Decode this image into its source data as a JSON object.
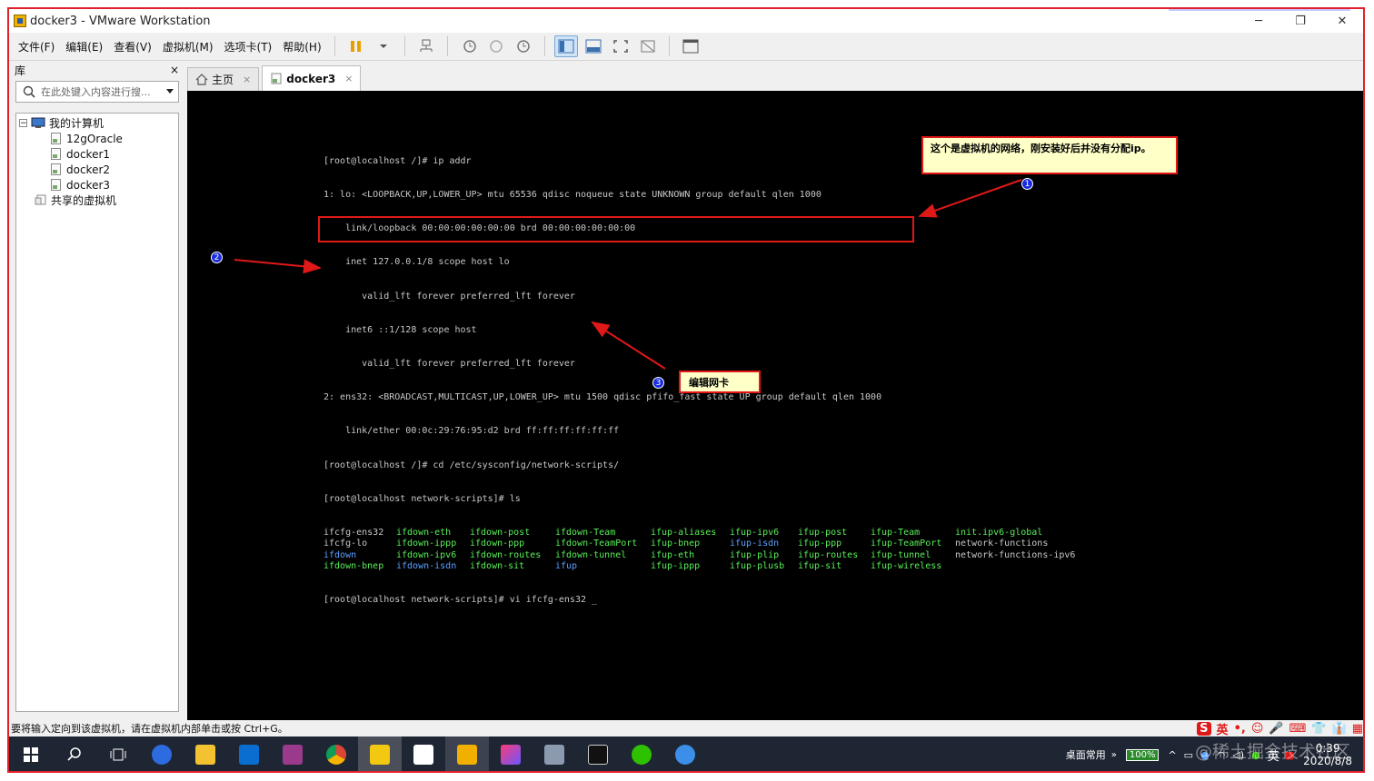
{
  "window": {
    "title": "docker3 - VMware Workstation",
    "minimize": "─",
    "restore": "❐",
    "close": "✕"
  },
  "menu": [
    "文件(F)",
    "编辑(E)",
    "查看(V)",
    "虚拟机(M)",
    "选项卡(T)",
    "帮助(H)"
  ],
  "library": {
    "title": "库",
    "close": "×",
    "search_placeholder": "在此处键入内容进行搜...",
    "tree": {
      "root": "我的计算机",
      "vms": [
        "12gOracle",
        "docker1",
        "docker2",
        "docker3"
      ],
      "shared": "共享的虚拟机"
    }
  },
  "tabs": [
    {
      "label": "主页",
      "close": "×"
    },
    {
      "label": "docker3",
      "close": "×"
    }
  ],
  "terminal": {
    "lines": [
      "[root@localhost /]# ip addr",
      "1: lo: <LOOPBACK,UP,LOWER_UP> mtu 65536 qdisc noqueue state UNKNOWN group default qlen 1000",
      "    link/loopback 00:00:00:00:00:00 brd 00:00:00:00:00:00",
      "    inet 127.0.0.1/8 scope host lo",
      "       valid_lft forever preferred_lft forever",
      "    inet6 ::1/128 scope host",
      "       valid_lft forever preferred_lft forever",
      "2: ens32: <BROADCAST,MULTICAST,UP,LOWER_UP> mtu 1500 qdisc pfifo_fast state UP group default qlen 1000",
      "    link/ether 00:0c:29:76:95:d2 brd ff:ff:ff:ff:ff:ff",
      "[root@localhost /]# cd /etc/sysconfig/network-scripts/",
      "[root@localhost network-scripts]# ls"
    ],
    "ls_rows": [
      [
        {
          "t": "ifcfg-ens32",
          "c": "w"
        },
        {
          "t": "ifdown-eth",
          "c": "g"
        },
        {
          "t": "ifdown-post",
          "c": "g"
        },
        {
          "t": "ifdown-Team",
          "c": "g"
        },
        {
          "t": "ifup-aliases",
          "c": "g"
        },
        {
          "t": "ifup-ipv6",
          "c": "g"
        },
        {
          "t": "ifup-post",
          "c": "g"
        },
        {
          "t": "ifup-Team",
          "c": "g"
        },
        {
          "t": "init.ipv6-global",
          "c": "g"
        }
      ],
      [
        {
          "t": "ifcfg-lo",
          "c": "w"
        },
        {
          "t": "ifdown-ippp",
          "c": "g"
        },
        {
          "t": "ifdown-ppp",
          "c": "g"
        },
        {
          "t": "ifdown-TeamPort",
          "c": "g"
        },
        {
          "t": "ifup-bnep",
          "c": "g"
        },
        {
          "t": "ifup-isdn",
          "c": "b"
        },
        {
          "t": "ifup-ppp",
          "c": "g"
        },
        {
          "t": "ifup-TeamPort",
          "c": "g"
        },
        {
          "t": "network-functions",
          "c": "w"
        }
      ],
      [
        {
          "t": "ifdown",
          "c": "b"
        },
        {
          "t": "ifdown-ipv6",
          "c": "g"
        },
        {
          "t": "ifdown-routes",
          "c": "g"
        },
        {
          "t": "ifdown-tunnel",
          "c": "g"
        },
        {
          "t": "ifup-eth",
          "c": "g"
        },
        {
          "t": "ifup-plip",
          "c": "g"
        },
        {
          "t": "ifup-routes",
          "c": "g"
        },
        {
          "t": "ifup-tunnel",
          "c": "g"
        },
        {
          "t": "network-functions-ipv6",
          "c": "w"
        }
      ],
      [
        {
          "t": "ifdown-bnep",
          "c": "g"
        },
        {
          "t": "ifdown-isdn",
          "c": "b"
        },
        {
          "t": "ifdown-sit",
          "c": "g"
        },
        {
          "t": "ifup",
          "c": "b"
        },
        {
          "t": "ifup-ippp",
          "c": "g"
        },
        {
          "t": "ifup-plusb",
          "c": "g"
        },
        {
          "t": "ifup-sit",
          "c": "g"
        },
        {
          "t": "ifup-wireless",
          "c": "g"
        },
        {
          "t": "",
          "c": "w"
        }
      ]
    ],
    "last_line": "[root@localhost network-scripts]# vi ifcfg-ens32 _"
  },
  "annotations": {
    "callout1": "这个是虚拟机的网络，刚安装好后并没有分配ip。",
    "callout3": "编辑网卡",
    "m1": "1",
    "m2": "2",
    "m3": "3"
  },
  "status": {
    "text": "要将输入定向到该虚拟机，请在虚拟机内部单击或按 Ctrl+G。",
    "ime": [
      "S",
      "英",
      "•,",
      "☺",
      "🎤",
      "⌨",
      "👕",
      "👔",
      "▦"
    ]
  },
  "taskbar": {
    "pinned": [
      "windows-start",
      "search",
      "task-view",
      "l-app",
      "file-explorer",
      "outlook",
      "rar",
      "chrome",
      "power-bi",
      "typora",
      "vmware",
      "jetbrains",
      "photos",
      "terminal",
      "wechat",
      "feishu"
    ],
    "desktop_label": "桌面常用",
    "battery": "100%",
    "ime_lang": "英",
    "time": "0:39",
    "date": "2020/8/8",
    "watermark": "@稀土掘金技术社区"
  },
  "colors": {
    "accent_red": "#e01818",
    "callout_bg": "#ffffc8",
    "marker_blue": "#1a2ce0",
    "terminal_green": "#58f058",
    "terminal_blue": "#5aa0ff"
  }
}
